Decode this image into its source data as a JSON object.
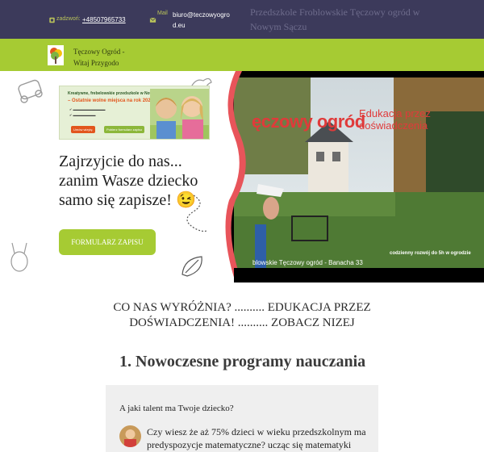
{
  "topbar": {
    "phone_label": "zadzwoń:",
    "phone_value": "+48507965733",
    "mail_label": "Mail",
    "mail_value": "biuro@teczowyogrod.eu",
    "title": "Przedszkole Froblowskie Tęczowy ogród w Nowym Sączu",
    "icons": [
      "phone-icon",
      "mail-icon"
    ]
  },
  "nav": {
    "brand_line1": "Tęczowy Ogród -",
    "brand_line2": "Witaj Przygodo"
  },
  "promo": {
    "headline": "Kreatywne, frebelowskie przedszkole w Nowym Sączu",
    "sub": "– Ostatnie wolne miejsca na rok 2026/2027!",
    "btn_primary": "Umów wizytę",
    "btn_secondary": "Pobierz formularz zapisu"
  },
  "hero": {
    "title": "Zajrzyjcie do nas... zanim Wasze dziecko samo się zapisze! 😉",
    "cta": "FORMULARZ ZAPISU"
  },
  "video": {
    "overlay_title": "ęczowy ogród",
    "overlay_sub": "Edukacja przez doświadczenia",
    "caption_left": "blowskie Tęczowy ogród - Banacha 33",
    "caption_right": "codzienny rozwój do 5h w ogrodzie"
  },
  "content": {
    "headline": "CO NAS WYRÓŻNIA? .......... EDUKACJA PRZEZ DOŚWIADCZENIA! .......... ZOBACZ NIZEJ",
    "section_title": "1. Nowoczesne programy nauczania",
    "card_question": "A jaki talent ma Twoje dziecko?",
    "card_text": "Czy wiesz że  aż 75% dzieci w wieku przedszkolnym ma predyspozycje matematyczne? ucząc się matematyki"
  },
  "colors": {
    "topbar_bg": "#3c3a5b",
    "accent_green": "#a6cb33",
    "video_border": "#e8545a",
    "overlay_red": "#e03a3a"
  }
}
